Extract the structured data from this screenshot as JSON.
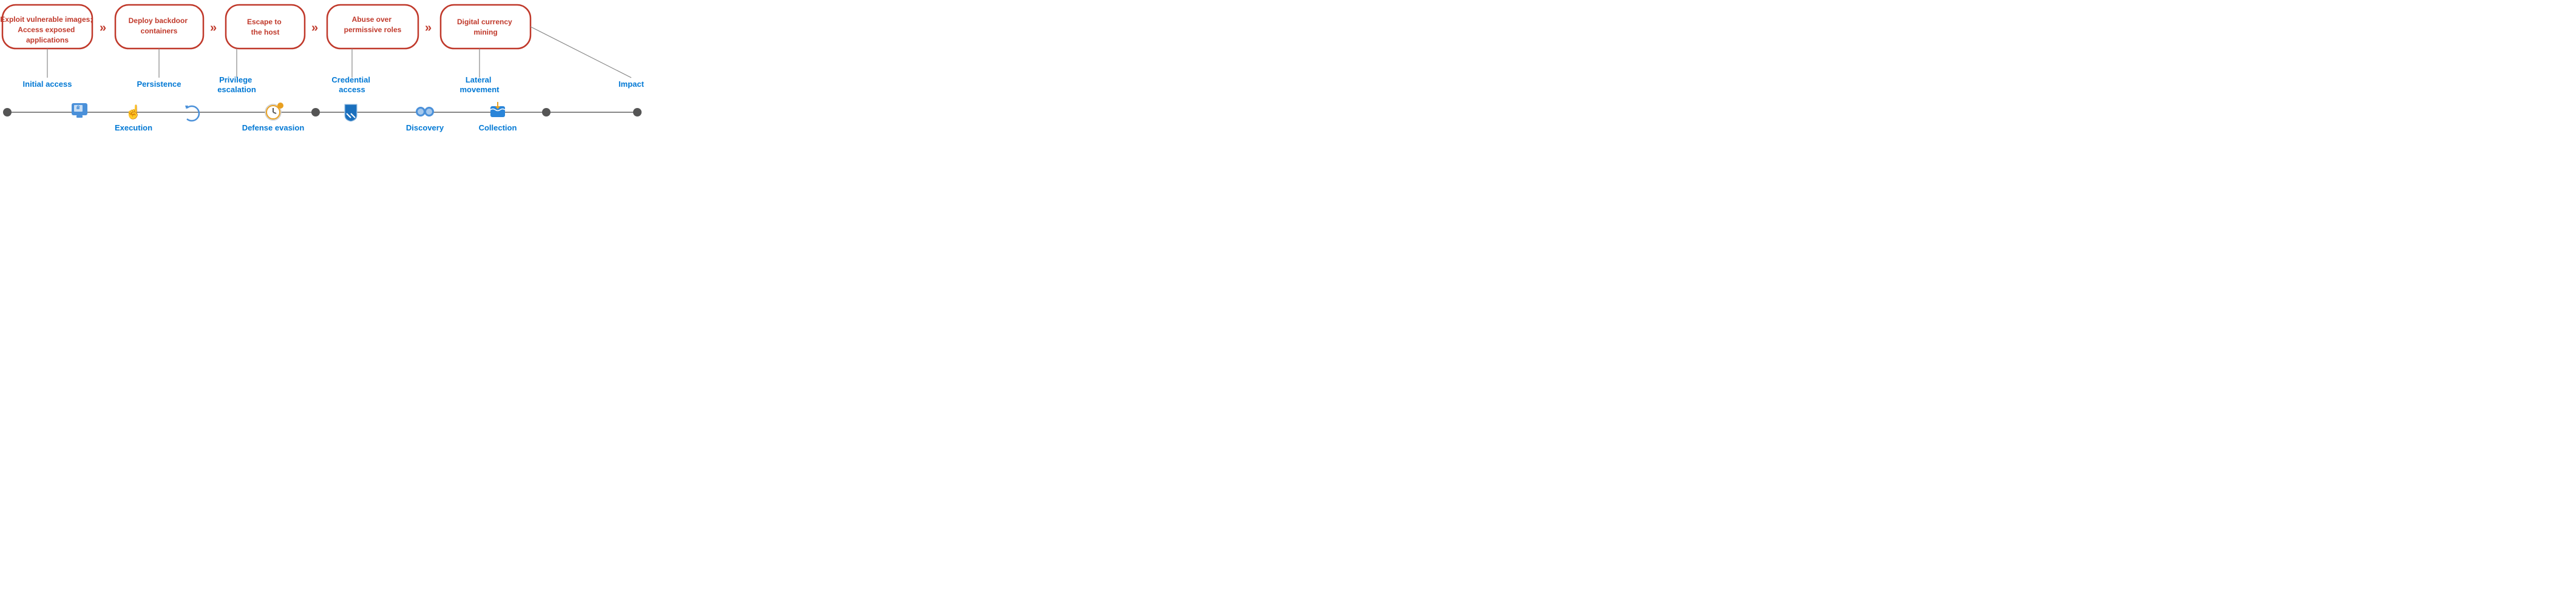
{
  "bubbles": [
    {
      "id": "bubble-exploit",
      "text": "Exploit vulnerable images;\nAccess exposed applications",
      "lines": 2
    },
    {
      "id": "bubble-deploy",
      "text": "Deploy backdoor\ncontainers",
      "lines": 2
    },
    {
      "id": "bubble-escape",
      "text": "Escape to\nthe host",
      "lines": 2
    },
    {
      "id": "bubble-abuse",
      "text": "Abuse over\npermissive roles",
      "lines": 2
    },
    {
      "id": "bubble-mining",
      "text": "Digital currency\nmining",
      "lines": 2
    }
  ],
  "top_labels": [
    {
      "id": "label-initial",
      "text": "Initial access"
    },
    {
      "id": "label-persistence",
      "text": "Persistence"
    },
    {
      "id": "label-privilege",
      "text": "Privilege\nescalation"
    },
    {
      "id": "label-credential",
      "text": "Credential\naccess"
    },
    {
      "id": "label-lateral",
      "text": "Lateral\nmovement"
    },
    {
      "id": "label-impact",
      "text": "Impact"
    }
  ],
  "bottom_labels": [
    {
      "id": "label-execution",
      "text": "Execution"
    },
    {
      "id": "label-defense",
      "text": "Defense evasion"
    },
    {
      "id": "label-discovery",
      "text": "Discovery"
    },
    {
      "id": "label-collection",
      "text": "Collection"
    }
  ],
  "colors": {
    "bubble_border": "#c0392b",
    "bubble_text": "#c0392b",
    "label_blue": "#0078d4",
    "timeline_gray": "#888888",
    "dot_dark": "#555555",
    "arrow_red": "#c0392b"
  }
}
